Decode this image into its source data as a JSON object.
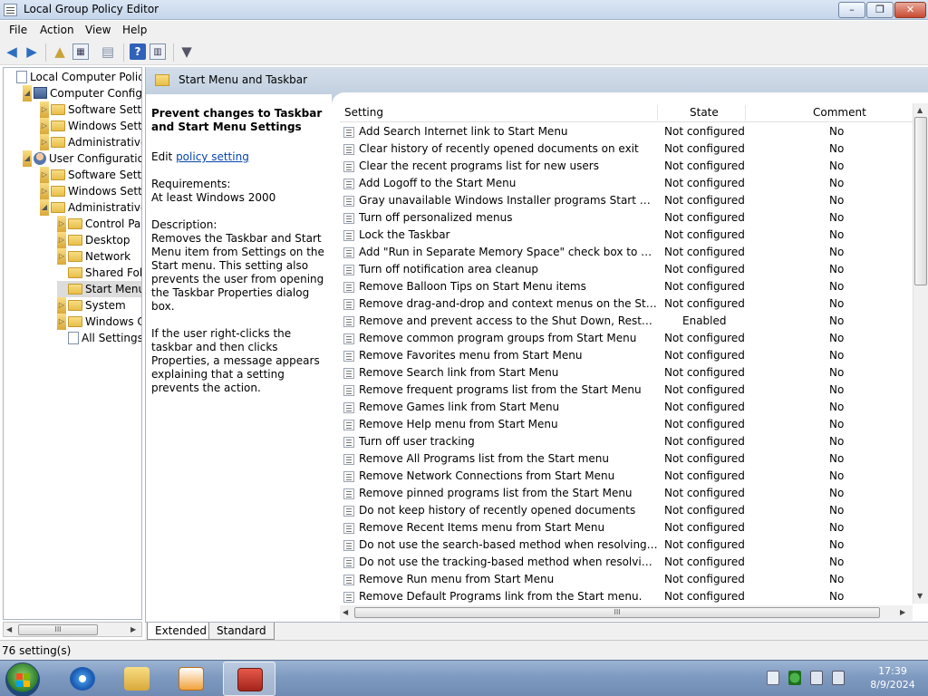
{
  "window": {
    "title": "Local Group Policy Editor",
    "min": "–",
    "max": "❐",
    "close": "✕"
  },
  "menu": [
    "File",
    "Action",
    "View",
    "Help"
  ],
  "tree": [
    {
      "label": "Local Computer Policy",
      "level": 0,
      "icon": "document-icon",
      "exp": ""
    },
    {
      "label": "Computer Configura",
      "level": 1,
      "icon": "computer-icon",
      "exp": "◢"
    },
    {
      "label": "Software Settings",
      "level": 2,
      "icon": "folder-icon",
      "exp": "▷"
    },
    {
      "label": "Windows Setting",
      "level": 2,
      "icon": "folder-icon",
      "exp": "▷"
    },
    {
      "label": "Administrative Te",
      "level": 2,
      "icon": "folder-icon",
      "exp": "▷"
    },
    {
      "label": "User Configuration",
      "level": 1,
      "icon": "user-icon",
      "exp": "◢"
    },
    {
      "label": "Software Settings",
      "level": 2,
      "icon": "folder-icon",
      "exp": "▷"
    },
    {
      "label": "Windows Setting",
      "level": 2,
      "icon": "folder-icon",
      "exp": "▷"
    },
    {
      "label": "Administrative Te",
      "level": 2,
      "icon": "folder-icon",
      "exp": "◢"
    },
    {
      "label": "Control Panel",
      "level": 3,
      "icon": "folder-icon",
      "exp": "▷"
    },
    {
      "label": "Desktop",
      "level": 3,
      "icon": "folder-icon",
      "exp": "▷"
    },
    {
      "label": "Network",
      "level": 3,
      "icon": "folder-icon",
      "exp": "▷"
    },
    {
      "label": "Shared Folder",
      "level": 3,
      "icon": "folder-icon",
      "exp": ""
    },
    {
      "label": "Start Menu an",
      "level": 3,
      "icon": "folder-icon",
      "exp": "",
      "selected": true
    },
    {
      "label": "System",
      "level": 3,
      "icon": "folder-icon",
      "exp": "▷"
    },
    {
      "label": "Windows Cor",
      "level": 3,
      "icon": "folder-icon",
      "exp": "▷"
    },
    {
      "label": "All Settings",
      "level": 3,
      "icon": "document-icon",
      "exp": ""
    }
  ],
  "pane": {
    "title": "Start Menu and Taskbar",
    "desc_title": "Prevent changes to Taskbar and Start Menu Settings",
    "edit_prefix": "Edit ",
    "edit_link": "policy setting",
    "requirements_label": "Requirements:",
    "requirements_value": "At least Windows 2000",
    "description_label": "Description:",
    "description_1": "Removes the Taskbar and Start Menu item from Settings on the Start menu. This setting also prevents the user from opening the Taskbar Properties dialog box.",
    "description_2": "If the user right-clicks the taskbar and then clicks Properties, a message appears explaining that a setting prevents the action."
  },
  "table": {
    "columns": {
      "setting": "Setting",
      "state": "State",
      "comment": "Comment"
    },
    "rows": [
      {
        "name": "Add Search Internet link to Start Menu",
        "state": "Not configured",
        "comment": "No"
      },
      {
        "name": "Clear history of recently opened documents on exit",
        "state": "Not configured",
        "comment": "No"
      },
      {
        "name": "Clear the recent programs list for new users",
        "state": "Not configured",
        "comment": "No"
      },
      {
        "name": "Add Logoff to the Start Menu",
        "state": "Not configured",
        "comment": "No"
      },
      {
        "name": "Gray unavailable Windows Installer programs Start Menu sh...",
        "state": "Not configured",
        "comment": "No"
      },
      {
        "name": "Turn off personalized menus",
        "state": "Not configured",
        "comment": "No"
      },
      {
        "name": "Lock the Taskbar",
        "state": "Not configured",
        "comment": "No"
      },
      {
        "name": "Add \"Run in Separate Memory Space\" check box to Run dial...",
        "state": "Not configured",
        "comment": "No"
      },
      {
        "name": "Turn off notification area cleanup",
        "state": "Not configured",
        "comment": "No"
      },
      {
        "name": "Remove Balloon Tips on Start Menu items",
        "state": "Not configured",
        "comment": "No"
      },
      {
        "name": "Remove drag-and-drop and context menus on the Start Me...",
        "state": "Not configured",
        "comment": "No"
      },
      {
        "name": "Remove and prevent access to the Shut Down, Restart, Sleep...",
        "state": "Enabled",
        "comment": "No"
      },
      {
        "name": "Remove common program groups from Start Menu",
        "state": "Not configured",
        "comment": "No"
      },
      {
        "name": "Remove Favorites menu from Start Menu",
        "state": "Not configured",
        "comment": "No"
      },
      {
        "name": "Remove Search link from Start Menu",
        "state": "Not configured",
        "comment": "No"
      },
      {
        "name": "Remove frequent programs list from the Start Menu",
        "state": "Not configured",
        "comment": "No"
      },
      {
        "name": "Remove Games link from Start Menu",
        "state": "Not configured",
        "comment": "No"
      },
      {
        "name": "Remove Help menu from Start Menu",
        "state": "Not configured",
        "comment": "No"
      },
      {
        "name": "Turn off user tracking",
        "state": "Not configured",
        "comment": "No"
      },
      {
        "name": "Remove All Programs list from the Start menu",
        "state": "Not configured",
        "comment": "No"
      },
      {
        "name": "Remove Network Connections from Start Menu",
        "state": "Not configured",
        "comment": "No"
      },
      {
        "name": "Remove pinned programs list from the Start Menu",
        "state": "Not configured",
        "comment": "No"
      },
      {
        "name": "Do not keep history of recently opened documents",
        "state": "Not configured",
        "comment": "No"
      },
      {
        "name": "Remove Recent Items menu from Start Menu",
        "state": "Not configured",
        "comment": "No"
      },
      {
        "name": "Do not use the search-based method when resolving shell s...",
        "state": "Not configured",
        "comment": "No"
      },
      {
        "name": "Do not use the tracking-based method when resolving shell ...",
        "state": "Not configured",
        "comment": "No"
      },
      {
        "name": "Remove Run menu from Start Menu",
        "state": "Not configured",
        "comment": "No"
      },
      {
        "name": "Remove Default Programs link from the Start menu.",
        "state": "Not configured",
        "comment": "No"
      }
    ]
  },
  "tabs": {
    "extended": "Extended",
    "standard": "Standard"
  },
  "status": "76 setting(s)",
  "clock": {
    "time": "17:39",
    "date": "8/9/2024"
  },
  "scroll_glyph": "III"
}
